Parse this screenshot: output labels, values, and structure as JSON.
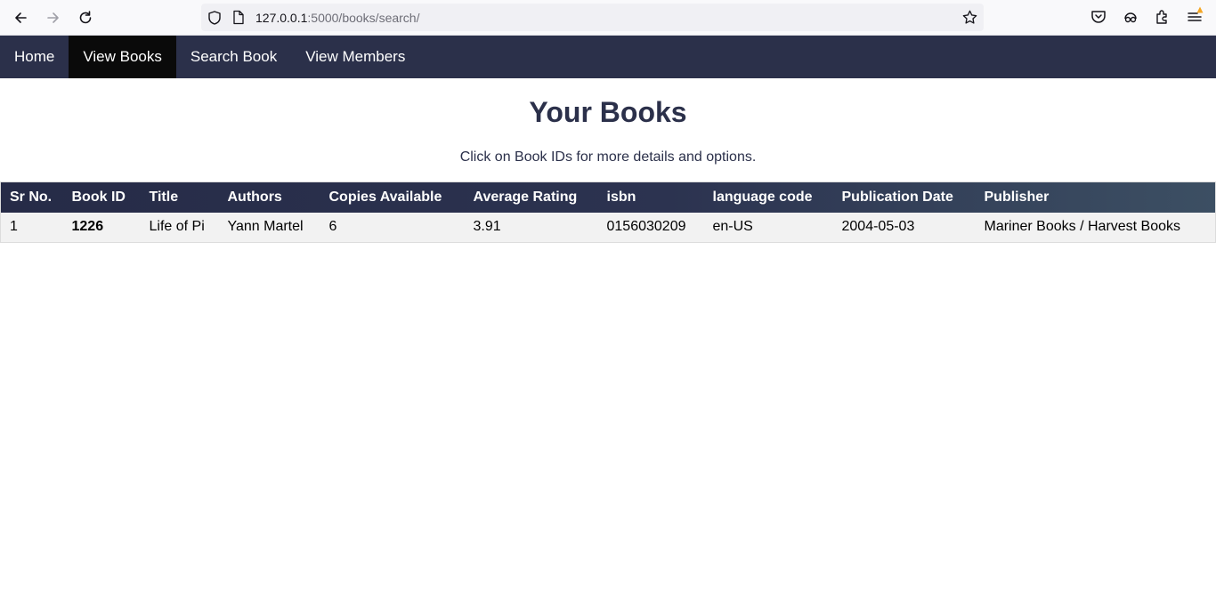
{
  "browser": {
    "url_host": "127.0.0.1",
    "url_path": ":5000/books/search/"
  },
  "nav": {
    "items": [
      {
        "label": "Home"
      },
      {
        "label": "View Books"
      },
      {
        "label": "Search Book"
      },
      {
        "label": "View Members"
      }
    ],
    "active_index": 1
  },
  "main": {
    "title": "Your Books",
    "subtitle": "Click on Book IDs for more details and options."
  },
  "table": {
    "headers": [
      "Sr No.",
      "Book ID",
      "Title",
      "Authors",
      "Copies Available",
      "Average Rating",
      "isbn",
      "language code",
      "Publication Date",
      "Publisher"
    ],
    "rows": [
      [
        "1",
        "1226",
        "Life of Pi",
        "Yann Martel",
        "6",
        "3.91",
        "0156030209",
        "en-US",
        "2004-05-03",
        "Mariner Books / Harvest Books"
      ]
    ]
  },
  "colors": {
    "nav_bg": "#2b304a",
    "nav_active_bg": "#0a0a0a",
    "title_color": "#2b304a",
    "notification_dot": "#f5a623"
  },
  "icons": [
    "back-arrow-icon",
    "forward-arrow-icon",
    "reload-icon",
    "shield-icon",
    "page-icon",
    "star-icon",
    "pocket-icon",
    "account-sync-icon",
    "extensions-icon",
    "menu-icon"
  ]
}
